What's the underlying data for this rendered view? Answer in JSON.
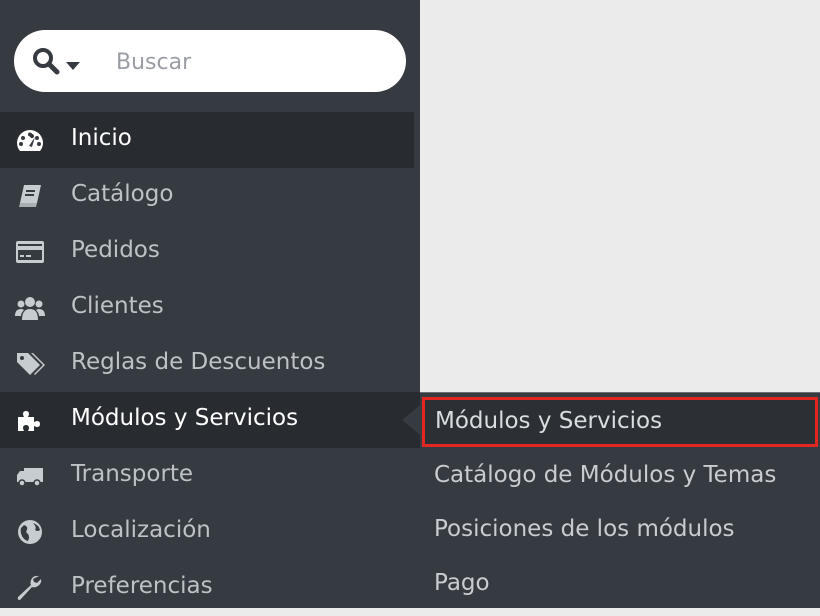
{
  "search": {
    "placeholder": "Buscar",
    "icon": "search-icon",
    "dropdown_icon": "caret-down-icon"
  },
  "sidebar": {
    "items": [
      {
        "label": "Inicio",
        "icon": "dashboard-icon"
      },
      {
        "label": "Catálogo",
        "icon": "book-icon"
      },
      {
        "label": "Pedidos",
        "icon": "credit-card-icon"
      },
      {
        "label": "Clientes",
        "icon": "users-icon"
      },
      {
        "label": "Reglas de Descuentos",
        "icon": "tags-icon"
      },
      {
        "label": "Módulos y Servicios",
        "icon": "puzzle-icon"
      },
      {
        "label": "Transporte",
        "icon": "truck-icon"
      },
      {
        "label": "Localización",
        "icon": "globe-icon"
      },
      {
        "label": "Preferencias",
        "icon": "wrench-icon"
      }
    ]
  },
  "submenu": {
    "items": [
      {
        "label": "Módulos y Servicios"
      },
      {
        "label": "Catálogo de Módulos y Temas"
      },
      {
        "label": "Posiciones de los módulos"
      },
      {
        "label": "Pago"
      }
    ]
  },
  "colors": {
    "sidebar_bg": "#363a41",
    "active_bg": "#282b30",
    "highlight_border": "#e3261f",
    "content_bg": "#ebebeb"
  }
}
